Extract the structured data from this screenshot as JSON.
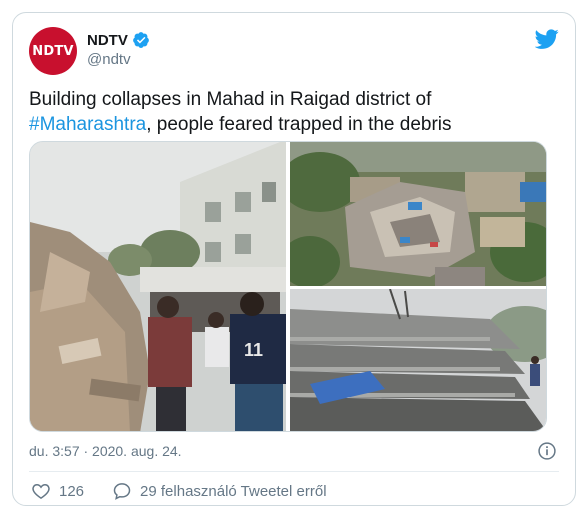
{
  "author": {
    "avatar_text": "NDTV",
    "display_name": "NDTV",
    "handle": "@ndtv",
    "verified": true
  },
  "tweet": {
    "text_part1": "Building collapses in Mahad in Raigad district of",
    "hashtag": "#Maharashtra",
    "text_part2": ", people feared trapped in the debris"
  },
  "media": {
    "count": 3
  },
  "meta": {
    "timestamp": "du. 3:57 · 2020. aug. 24."
  },
  "actions": {
    "like_count": "126",
    "reply_label": "29 felhasználó Tweetel erről"
  },
  "colors": {
    "accent": "#1b95e0",
    "brand_red": "#c8102e",
    "text": "#14171a",
    "muted": "#657786"
  },
  "icons": [
    "verified-badge-icon",
    "twitter-bird-icon",
    "info-icon",
    "heart-icon",
    "chat-bubble-icon"
  ]
}
